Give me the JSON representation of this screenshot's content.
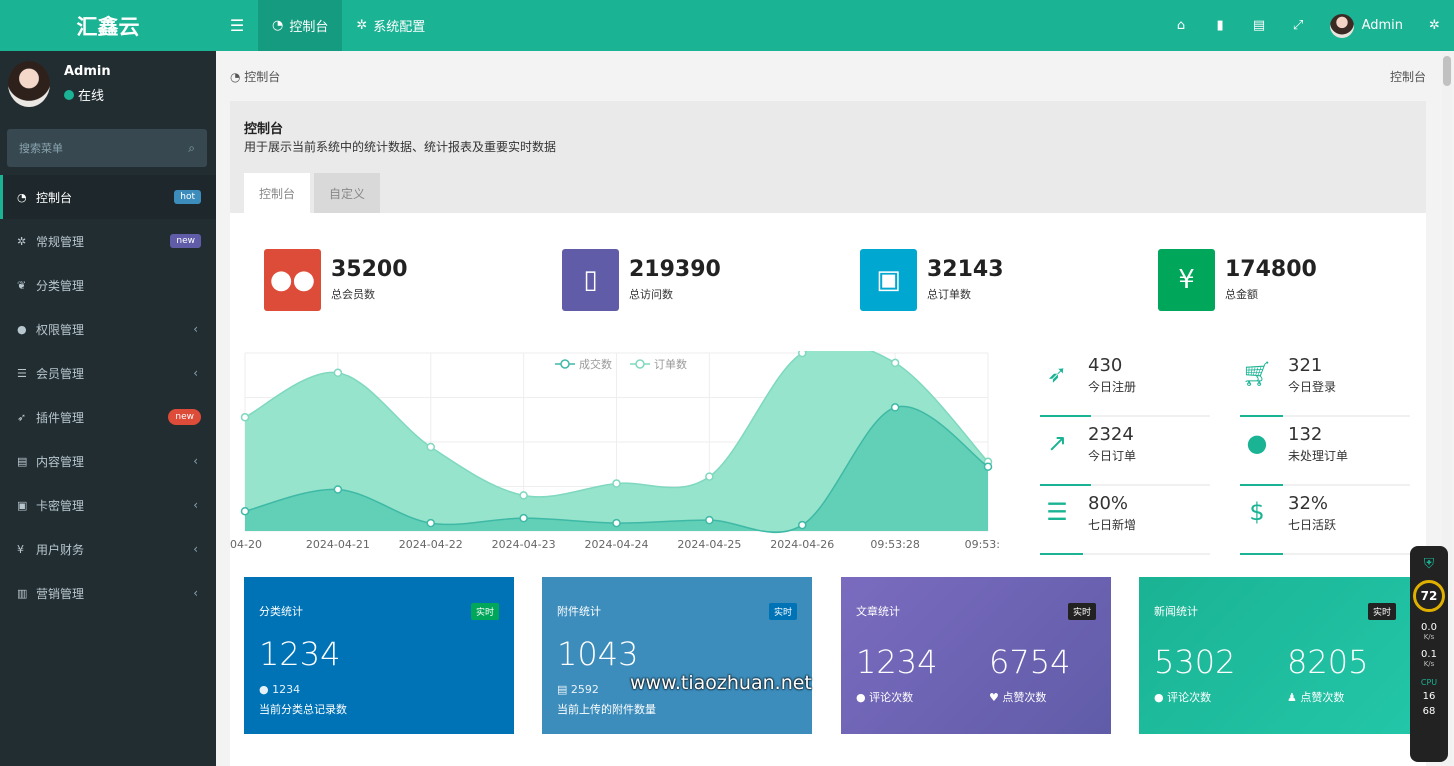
{
  "app": {
    "logo": "汇鑫云"
  },
  "topbar": {
    "tabs": [
      {
        "label": "控制台",
        "icon": "dashboard-icon"
      },
      {
        "label": "系统配置",
        "icon": "gear-icon"
      }
    ],
    "user_name": "Admin"
  },
  "sidebar": {
    "user": {
      "name": "Admin",
      "status": "在线"
    },
    "search_placeholder": "搜索菜单",
    "items": [
      {
        "label": "控制台",
        "badge": "hot"
      },
      {
        "label": "常规管理",
        "badge": "new"
      },
      {
        "label": "分类管理"
      },
      {
        "label": "权限管理"
      },
      {
        "label": "会员管理"
      },
      {
        "label": "插件管理",
        "badge": "new"
      },
      {
        "label": "内容管理"
      },
      {
        "label": "卡密管理"
      },
      {
        "label": "用户财务"
      },
      {
        "label": "营销管理"
      }
    ]
  },
  "breadcrumb": {
    "label": "控制台",
    "right": "控制台"
  },
  "panel": {
    "title": "控制台",
    "description": "用于展示当前系统中的统计数据、统计报表及重要实时数据",
    "tabs": [
      "控制台",
      "自定义"
    ]
  },
  "stats": [
    {
      "value": "35200",
      "label": "总会员数",
      "color": "#dd4b39",
      "icon": "users-icon"
    },
    {
      "value": "219390",
      "label": "总访问数",
      "color": "#605ca8",
      "icon": "book-icon"
    },
    {
      "value": "32143",
      "label": "总订单数",
      "color": "#00a7d0",
      "icon": "shopping-bag-icon"
    },
    {
      "value": "174800",
      "label": "总金额",
      "color": "#00a65a",
      "icon": "yen-icon"
    }
  ],
  "mini_stats": [
    {
      "value": "430",
      "label": "今日注册",
      "icon": "rocket-icon",
      "progress": 0.3
    },
    {
      "value": "321",
      "label": "今日登录",
      "icon": "cart-icon",
      "progress": 0.25
    },
    {
      "value": "2324",
      "label": "今日订单",
      "icon": "area-chart-icon",
      "progress": 0.3
    },
    {
      "value": "132",
      "label": "未处理订单",
      "icon": "users-icon",
      "progress": 0.25
    },
    {
      "value": "80%",
      "label": "七日新增",
      "icon": "list-icon",
      "progress": 0.25
    },
    {
      "value": "32%",
      "label": "七日活跃",
      "icon": "dollar-icon",
      "progress": 0.25
    }
  ],
  "chart_data": {
    "type": "area",
    "x": [
      "04-20",
      "2024-04-21",
      "2024-04-22",
      "2024-04-23",
      "2024-04-24",
      "2024-04-25",
      "2024-04-26",
      "09:53:28",
      "09:53:"
    ],
    "series": [
      {
        "name": "成交数",
        "values": [
          200,
          420,
          80,
          130,
          80,
          110,
          60,
          1250,
          650
        ]
      },
      {
        "name": "订单数",
        "values": [
          1150,
          1600,
          850,
          360,
          480,
          550,
          1800,
          1700,
          700
        ]
      }
    ],
    "ylim": [
      0,
      1800
    ],
    "legend": "top-center",
    "grid": true
  },
  "cards": [
    {
      "title": "分类统计",
      "tag": "实时",
      "value": "1234",
      "sub": "1234",
      "note": "当前分类总记录数",
      "color": "#0073b7",
      "tag_color": "#00a65a"
    },
    {
      "title": "附件统计",
      "tag": "实时",
      "value": "1043",
      "sub": "2592",
      "note": "当前上传的附件数量",
      "color": "#3c8dbc",
      "tag_color": "#0073b7"
    },
    {
      "title": "文章统计",
      "tag": "实时",
      "value1": "1234",
      "label1": "评论次数",
      "value2": "6754",
      "label2": "点赞次数",
      "color": "#605ca8",
      "tag_color": "#222"
    },
    {
      "title": "新闻统计",
      "tag": "实时",
      "value1": "5302",
      "label1": "评论次数",
      "value2": "8205",
      "label2": "点赞次数",
      "color": "#1ab394",
      "tag_color": "#222"
    }
  ],
  "monitor": {
    "percent": "72",
    "up": "0.0",
    "up_unit": "K/s",
    "down": "0.1",
    "down_unit": "K/s",
    "cpu_label": "CPU",
    "cpu_usage": "16",
    "cpu_temp": "68"
  },
  "watermark": "www.tiaozhuan.net"
}
